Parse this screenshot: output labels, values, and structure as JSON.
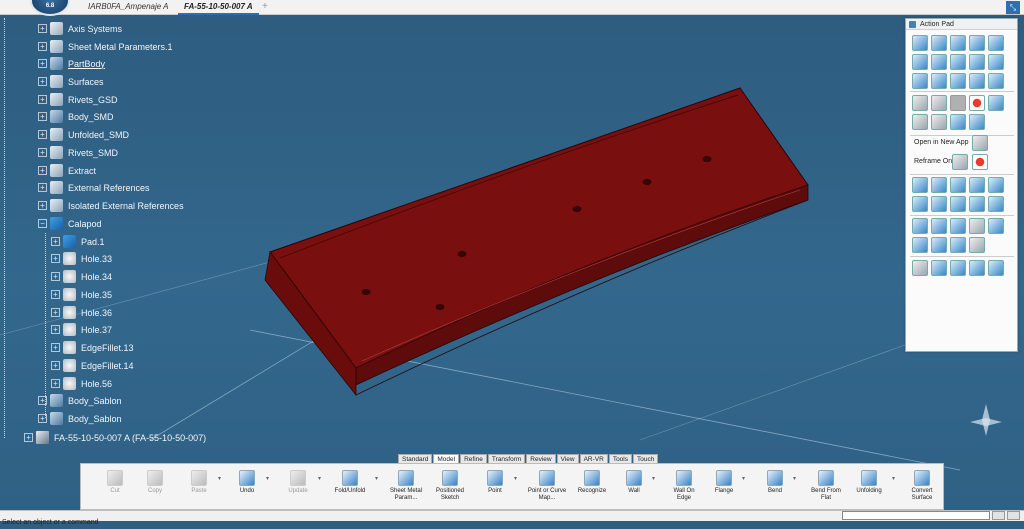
{
  "app": {
    "logo_version": "6.8"
  },
  "tabs": [
    {
      "label": "IARB0FA_Ampenaje A"
    },
    {
      "label": "FA-55-10-50-007 A"
    }
  ],
  "add_tab": "+",
  "tree": {
    "items": [
      {
        "label": "Axis Systems",
        "icon": "axis-icon"
      },
      {
        "label": "Sheet Metal Parameters.1",
        "icon": "parameters-icon"
      },
      {
        "label": "PartBody",
        "icon": "partbody-icon"
      },
      {
        "label": "Surfaces",
        "icon": "geometrical-set-icon"
      },
      {
        "label": "Rivets_GSD",
        "icon": "geometrical-set-icon"
      },
      {
        "label": "Body_SMD",
        "icon": "body-icon"
      },
      {
        "label": "Unfolded_SMD",
        "icon": "geometrical-set-icon"
      },
      {
        "label": "Rivets_SMD",
        "icon": "geometrical-set-icon"
      },
      {
        "label": "Extract",
        "icon": "geometrical-set-icon"
      },
      {
        "label": "External References",
        "icon": "geometrical-set-icon"
      },
      {
        "label": "Isolated External References",
        "icon": "geometrical-set-icon"
      },
      {
        "label": "Calapod",
        "icon": "body-icon"
      },
      {
        "label": "Pad.1",
        "icon": "pad-icon"
      },
      {
        "label": "Hole.33",
        "icon": "hole-icon"
      },
      {
        "label": "Hole.34",
        "icon": "hole-icon"
      },
      {
        "label": "Hole.35",
        "icon": "hole-icon"
      },
      {
        "label": "Hole.36",
        "icon": "hole-icon"
      },
      {
        "label": "Hole.37",
        "icon": "hole-icon"
      },
      {
        "label": "EdgeFillet.13",
        "icon": "fillet-icon"
      },
      {
        "label": "EdgeFillet.14",
        "icon": "fillet-icon"
      },
      {
        "label": "Hole.56",
        "icon": "hole-icon"
      },
      {
        "label": "Body_Sablon",
        "icon": "body-icon"
      },
      {
        "label": "Body_Sablon",
        "icon": "body-icon"
      },
      {
        "label": "FA-55-10-50-007 A (FA-55-10-50-007)",
        "icon": "product-icon"
      }
    ]
  },
  "action_pad": {
    "title": "Action Pad",
    "open_in_new_app": "Open in New App",
    "reframe_on": "Reframe On"
  },
  "section_tabs": [
    "Standard",
    "Model",
    "Refine",
    "Transform",
    "Review",
    "View",
    "AR-VR",
    "Tools",
    "Touch"
  ],
  "active_section": "Model",
  "toolbar": [
    {
      "label": "Cut",
      "enabled": false
    },
    {
      "label": "Copy",
      "enabled": false
    },
    {
      "label": "Paste",
      "enabled": false
    },
    {
      "label": "Undo",
      "enabled": true
    },
    {
      "label": "Update",
      "enabled": false
    },
    {
      "label": "Fold/Unfold",
      "enabled": true
    },
    {
      "label": "Sheet Metal Param...",
      "enabled": true
    },
    {
      "label": "Positioned Sketch",
      "enabled": true
    },
    {
      "label": "Point",
      "enabled": true
    },
    {
      "label": "Point or Curve Map...",
      "enabled": true
    },
    {
      "label": "Recognize",
      "enabled": true
    },
    {
      "label": "Wall",
      "enabled": true
    },
    {
      "label": "Wall On Edge",
      "enabled": true
    },
    {
      "label": "Flange",
      "enabled": true
    },
    {
      "label": "Bend",
      "enabled": true
    },
    {
      "label": "Bend From Flat",
      "enabled": true
    },
    {
      "label": "Unfolding",
      "enabled": true
    },
    {
      "label": "Convert Surface",
      "enabled": true
    }
  ],
  "status": {
    "prompt": "Select an object or a command"
  },
  "colors": {
    "part": "#7a0f0f",
    "background": "#2f6185",
    "accent": "#2a6fb3"
  }
}
